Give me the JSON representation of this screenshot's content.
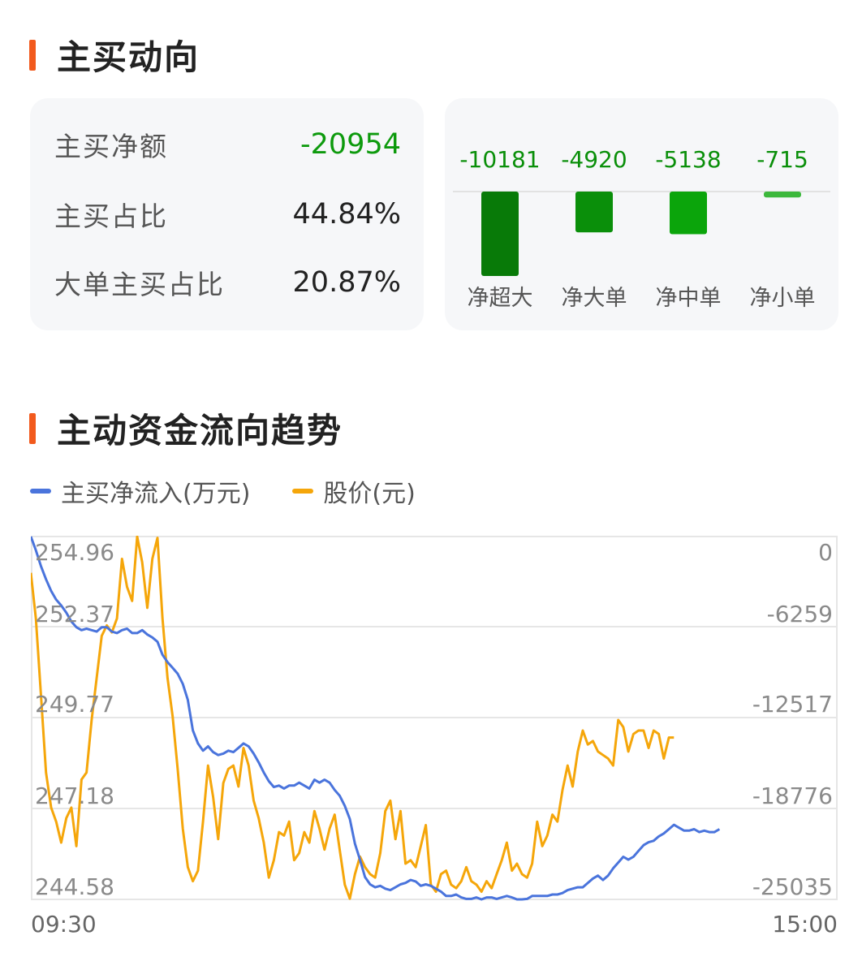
{
  "section1": {
    "title": "主买动向"
  },
  "summary": {
    "rows": [
      {
        "label": "主买净额",
        "value": "-20954"
      },
      {
        "label": "主买占比",
        "value": "44.84%"
      },
      {
        "label": "大单主买占比",
        "value": "20.87%"
      }
    ]
  },
  "colors": {
    "accent": "#f25a1d",
    "green_dark": "#087a08",
    "green_mid": "#0a8f0a",
    "green": "#0ba50b",
    "green_light": "#3cb83c",
    "blue_line": "#4a74dc",
    "orange_line": "#f5a60a"
  },
  "net_flow": {
    "categories": [
      "净超大",
      "净大单",
      "净中单",
      "净小单"
    ],
    "values": [
      -10181,
      -4920,
      -5138,
      -715
    ],
    "labels": [
      "-10181",
      "-4920",
      "-5138",
      "-715"
    ]
  },
  "section2": {
    "title": "主动资金流向趋势"
  },
  "chart_data": {
    "type": "line",
    "legend": [
      "主买净流入(万元)",
      "股价(元)"
    ],
    "x_start_label": "09:30",
    "x_end_label": "15:00",
    "left_axis_ticks": [
      "254.96",
      "252.37",
      "249.77",
      "247.18",
      "244.58"
    ],
    "right_axis_ticks": [
      "0",
      "-6259",
      "-12517",
      "-18776",
      "-25035"
    ],
    "price_range": [
      244.58,
      254.96
    ],
    "flow_range": [
      -25035,
      0
    ],
    "points_total": 240,
    "series": [
      {
        "name": "主买净流入(万元)",
        "axis": "right",
        "values": [
          0,
          -1000,
          -2100,
          -3000,
          -3800,
          -4400,
          -4800,
          -5300,
          -5900,
          -6300,
          -6500,
          -6400,
          -6500,
          -6600,
          -6300,
          -6300,
          -6600,
          -6700,
          -6500,
          -6400,
          -6700,
          -6700,
          -6500,
          -6800,
          -7000,
          -7300,
          -8200,
          -8700,
          -9100,
          -9500,
          -10200,
          -11300,
          -13400,
          -14300,
          -14800,
          -14500,
          -14900,
          -15100,
          -15000,
          -14800,
          -14900,
          -14600,
          -14300,
          -14500,
          -15000,
          -15600,
          -16300,
          -16900,
          -17300,
          -17200,
          -17400,
          -17200,
          -17200,
          -17000,
          -17200,
          -17400,
          -16800,
          -17000,
          -16800,
          -17000,
          -17500,
          -17900,
          -18600,
          -19500,
          -21200,
          -22300,
          -23500,
          -24000,
          -24200,
          -24100,
          -24300,
          -24400,
          -24200,
          -24000,
          -23900,
          -23700,
          -23800,
          -24100,
          -24000,
          -24100,
          -24300,
          -24500,
          -24800,
          -24800,
          -24700,
          -24900,
          -25000,
          -25000,
          -24900,
          -25100,
          -24900,
          -24900,
          -25000,
          -24900,
          -24800,
          -24900,
          -25100,
          -25200,
          -25000,
          -24800,
          -24800,
          -24800,
          -24800,
          -24700,
          -24700,
          -24600,
          -24400,
          -24300,
          -24200,
          -24200,
          -23900,
          -23600,
          -23400,
          -23700,
          -23400,
          -22900,
          -22500,
          -22100,
          -22300,
          -22100,
          -21700,
          -21300,
          -21100,
          -21000,
          -20700,
          -20500,
          -20200,
          -19900,
          -20100,
          -20300,
          -20300,
          -20200,
          -20400,
          -20300,
          -20400,
          -20400,
          -20200
        ]
      },
      {
        "name": "股价(元)",
        "axis": "left",
        "values": [
          253.9,
          252.6,
          250.4,
          248.2,
          247.2,
          246.8,
          246.2,
          246.9,
          247.2,
          246.1,
          248.0,
          248.2,
          249.7,
          250.9,
          252.1,
          252.4,
          252.2,
          252.6,
          254.3,
          253.5,
          253.1,
          255.1,
          254.2,
          252.9,
          254.3,
          254.9,
          252.6,
          250.9,
          249.8,
          248.3,
          246.6,
          245.5,
          245.1,
          245.4,
          246.8,
          248.4,
          247.5,
          246.3,
          247.9,
          248.3,
          248.4,
          247.8,
          248.9,
          248.4,
          247.4,
          246.9,
          246.2,
          245.2,
          245.7,
          246.5,
          246.4,
          246.8,
          245.7,
          245.9,
          246.5,
          246.2,
          247.1,
          246.6,
          246.0,
          246.6,
          247.0,
          246.0,
          245.0,
          244.6,
          245.3,
          245.8,
          245.5,
          245.3,
          245.2,
          245.9,
          247.1,
          247.4,
          246.3,
          247.1,
          245.6,
          245.7,
          245.5,
          246.1,
          246.7,
          245.0,
          244.8,
          245.3,
          245.4,
          245.0,
          244.9,
          245.1,
          245.5,
          245.1,
          245.0,
          244.8,
          245.1,
          244.9,
          245.3,
          245.7,
          246.2,
          245.4,
          245.6,
          245.3,
          245.2,
          245.6,
          246.8,
          246.1,
          246.4,
          247.0,
          246.8,
          247.7,
          248.4,
          247.8,
          248.8,
          249.4,
          249.0,
          249.1,
          248.8,
          248.7,
          248.6,
          248.4,
          249.7,
          249.5,
          248.8,
          249.3,
          249.4,
          249.4,
          248.9,
          249.4,
          249.3,
          248.6,
          249.2,
          249.2
        ]
      }
    ]
  }
}
